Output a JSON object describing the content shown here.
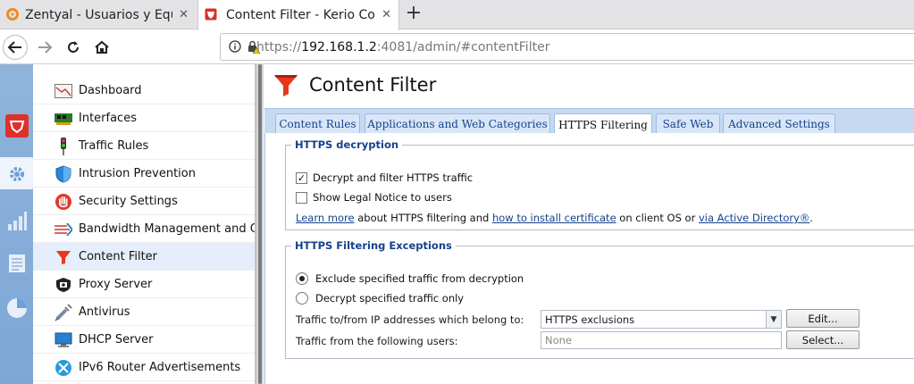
{
  "browser": {
    "tabs": [
      {
        "title": "Zentyal - Usuarios y Equi",
        "close": "✕"
      },
      {
        "title": "Content Filter - Kerio Con",
        "close": "✕"
      }
    ],
    "new_tab": "+",
    "url": {
      "scheme": "https://",
      "host": "192.168.1.2",
      "rest": ":4081/admin/#contentFilter"
    }
  },
  "sidebar": {
    "items": [
      {
        "label": "Dashboard",
        "icon": "dashboard-icon"
      },
      {
        "label": "Interfaces",
        "icon": "network-card-icon"
      },
      {
        "label": "Traffic Rules",
        "icon": "traffic-light-icon"
      },
      {
        "label": "Intrusion Prevention",
        "icon": "shield-icon"
      },
      {
        "label": "Security Settings",
        "icon": "hand-stop-icon"
      },
      {
        "label": "Bandwidth Management and QoS",
        "icon": "bandwidth-arrows-icon"
      },
      {
        "label": "Content Filter",
        "icon": "funnel-icon"
      },
      {
        "label": "Proxy Server",
        "icon": "proxy-shield-icon"
      },
      {
        "label": "Antivirus",
        "icon": "syringe-icon"
      },
      {
        "label": "DHCP Server",
        "icon": "monitor-icon"
      },
      {
        "label": "IPv6 Router Advertisements",
        "icon": "router-icon"
      }
    ],
    "selected": "Content Filter"
  },
  "page": {
    "title": "Content Filter",
    "tabs": [
      "Content Rules",
      "Applications and Web Categories",
      "HTTPS Filtering",
      "Safe Web",
      "Advanced Settings"
    ],
    "active_tab": "HTTPS Filtering"
  },
  "https_decryption": {
    "legend": "HTTPS decryption",
    "decrypt_label": "Decrypt and filter HTTPS traffic",
    "decrypt_checked": true,
    "legal_label": "Show Legal Notice to users",
    "legal_checked": false,
    "info": {
      "link1": "Learn more",
      "text1": " about HTTPS filtering and ",
      "link2": "how to install certificate",
      "text2": " on client OS or ",
      "link3": "via Active Directory®",
      "text3": "."
    }
  },
  "exceptions": {
    "legend": "HTTPS Filtering Exceptions",
    "radio1": "Exclude specified traffic from decryption",
    "radio2": "Decrypt specified traffic only",
    "selected": "radio1",
    "ip_label": "Traffic to/from IP addresses which belong to:",
    "ip_value": "HTTPS exclusions",
    "edit_button": "Edit...",
    "users_label": "Traffic from the following users:",
    "users_placeholder": "None",
    "select_button": "Select..."
  },
  "colors": {
    "accent": "#15428b",
    "selection": "#e5eefa",
    "rail": "#8fb4dc",
    "funnel": "#e8371d"
  }
}
